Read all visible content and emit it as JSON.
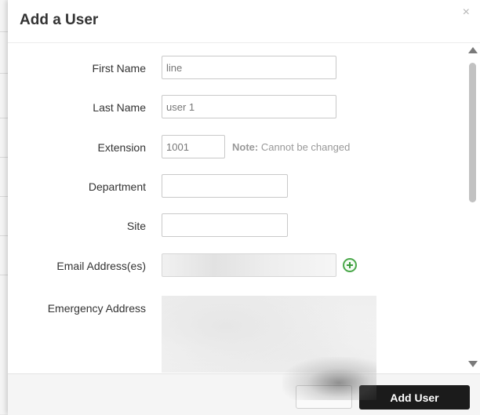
{
  "modal": {
    "title": "Add a User",
    "close_glyph": "×"
  },
  "form": {
    "first_name": {
      "label": "First Name",
      "value": "line"
    },
    "last_name": {
      "label": "Last Name",
      "value": "user 1"
    },
    "extension": {
      "label": "Extension",
      "value": "1001",
      "note_bold": "Note:",
      "note_text": " Cannot be changed"
    },
    "department": {
      "label": "Department",
      "value": ""
    },
    "site": {
      "label": "Site",
      "value": ""
    },
    "email": {
      "label": "Email Address(es)",
      "add_icon": "plus-circle-icon"
    },
    "emergency_address": {
      "label": "Emergency Address"
    }
  },
  "footer": {
    "cancel_label": "",
    "add_user_label": "Add User"
  },
  "colors": {
    "primary_button": "#1b1b1b",
    "add_icon": "#3a9a3a"
  }
}
